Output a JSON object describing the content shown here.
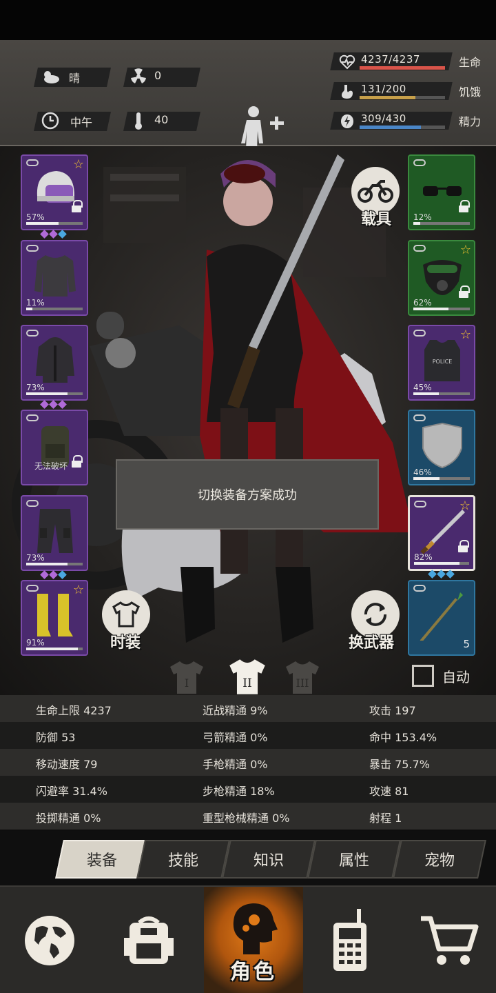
{
  "environment": {
    "weather": "晴",
    "radiation": "0",
    "time_of_day": "中午",
    "temperature": "40"
  },
  "vitals": [
    {
      "value": "4237/4237",
      "label": "生命",
      "fraction": 1.0,
      "color": "#d9544a",
      "icon": "heart-pulse-icon"
    },
    {
      "value": "131/200",
      "label": "饥饿",
      "fraction": 0.655,
      "color": "#c7a04a",
      "icon": "stomach-icon"
    },
    {
      "value": "309/430",
      "label": "精力",
      "fraction": 0.719,
      "color": "#4a86c7",
      "icon": "energy-bolt-icon"
    }
  ],
  "left_slots": [
    {
      "id": "helmet",
      "rarity": "purple",
      "pct": "57%",
      "durability": 0.57,
      "star": true,
      "lock": true,
      "gems": [
        "#b06ad8",
        "#b06ad8",
        "#4aa8e0"
      ],
      "icon": "police-helmet-icon"
    },
    {
      "id": "shirt",
      "rarity": "purple",
      "pct": "11%",
      "durability": 0.11,
      "star": false,
      "lock": false,
      "gems": [],
      "icon": "jacket-icon"
    },
    {
      "id": "coat",
      "rarity": "purple",
      "pct": "73%",
      "durability": 0.73,
      "star": false,
      "lock": false,
      "gems": [
        "#b06ad8",
        "#b06ad8",
        "#b06ad8"
      ],
      "icon": "hooded-coat-icon"
    },
    {
      "id": "backpack",
      "rarity": "purple",
      "pct": "",
      "note": "无法破坏",
      "durability": 0,
      "star": false,
      "lock": true,
      "gems": [],
      "icon": "backpack-icon"
    },
    {
      "id": "pants",
      "rarity": "purple",
      "pct": "73%",
      "durability": 0.73,
      "star": false,
      "lock": false,
      "gems": [
        "#b06ad8",
        "#b06ad8",
        "#4aa8e0"
      ],
      "icon": "cargo-pants-icon"
    },
    {
      "id": "boots",
      "rarity": "purple",
      "pct": "91%",
      "durability": 0.91,
      "star": true,
      "lock": false,
      "gems": [],
      "icon": "yellow-boots-icon"
    }
  ],
  "right_slots": [
    {
      "id": "glasses",
      "rarity": "green",
      "pct": "12%",
      "durability": 0.12,
      "star": false,
      "lock": true,
      "gems": [],
      "icon": "sunglasses-icon"
    },
    {
      "id": "mask",
      "rarity": "green",
      "pct": "62%",
      "durability": 0.62,
      "star": true,
      "lock": true,
      "gems": [],
      "icon": "gas-mask-icon"
    },
    {
      "id": "vest",
      "rarity": "purple",
      "pct": "45%",
      "durability": 0.45,
      "star": true,
      "lock": false,
      "gems": [],
      "icon": "police-vest-icon"
    },
    {
      "id": "shield",
      "rarity": "blue",
      "pct": "46%",
      "durability": 0.46,
      "star": false,
      "lock": false,
      "gems": [],
      "icon": "shield-icon"
    },
    {
      "id": "sword",
      "rarity": "purple",
      "pct": "82%",
      "durability": 0.82,
      "star": true,
      "lock": true,
      "gems": [
        "#4aa8e0",
        "#4aa8e0",
        "#4aa8e0"
      ],
      "icon": "sword-icon",
      "selected": true
    },
    {
      "id": "spear",
      "rarity": "blue",
      "pct": "",
      "count": "5",
      "durability": 0,
      "star": false,
      "lock": false,
      "gems": [],
      "icon": "spear-icon"
    }
  ],
  "buttons": {
    "vehicle": "载具",
    "fashion": "时装",
    "switch_weapon": "换武器"
  },
  "toast": "切换装备方案成功",
  "loadouts": {
    "options": [
      "I",
      "II",
      "III"
    ],
    "selected": "II"
  },
  "auto_label": "自动",
  "stats": [
    [
      {
        "label": "生命上限",
        "value": "4237"
      },
      {
        "label": "近战精通",
        "value": "9%"
      },
      {
        "label": "攻击",
        "value": "197"
      }
    ],
    [
      {
        "label": "防御",
        "value": "53"
      },
      {
        "label": "弓箭精通",
        "value": "0%"
      },
      {
        "label": "命中",
        "value": "153.4%"
      }
    ],
    [
      {
        "label": "移动速度",
        "value": "79"
      },
      {
        "label": "手枪精通",
        "value": "0%"
      },
      {
        "label": "暴击",
        "value": "75.7%"
      }
    ],
    [
      {
        "label": "闪避率",
        "value": "31.4%"
      },
      {
        "label": "步枪精通",
        "value": "18%"
      },
      {
        "label": "攻速",
        "value": "81"
      }
    ],
    [
      {
        "label": "投掷精通",
        "value": "0%"
      },
      {
        "label": "重型枪械精通",
        "value": "0%"
      },
      {
        "label": "射程",
        "value": "1"
      }
    ]
  ],
  "tabs": [
    "装备",
    "技能",
    "知识",
    "属性",
    "宠物"
  ],
  "active_tab": "装备",
  "nav": {
    "items": [
      "globe-icon",
      "backpack-icon",
      "character-head-icon",
      "walkie-talkie-icon",
      "shopping-cart-icon"
    ],
    "active_label": "角色"
  }
}
